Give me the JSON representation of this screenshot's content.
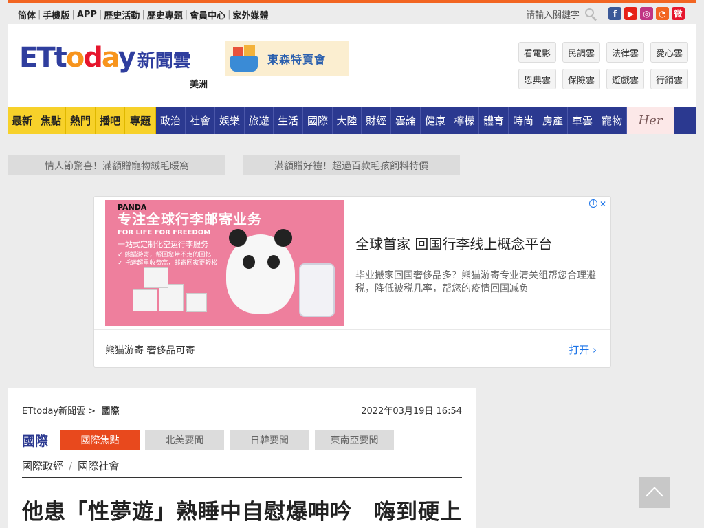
{
  "topbar": {
    "links": [
      "简体",
      "手機版",
      "APP",
      "歷史活動",
      "歷史專題",
      "會員中心",
      "家外媒體"
    ],
    "search_label": "請輸入關鍵字",
    "social": [
      {
        "name": "facebook-icon",
        "glyph": "f",
        "color": "#3b5998"
      },
      {
        "name": "youtube-icon",
        "glyph": "▶",
        "color": "#e62117"
      },
      {
        "name": "instagram-icon",
        "glyph": "◎",
        "color": "#c13584"
      },
      {
        "name": "rss-icon",
        "glyph": "◔",
        "color": "#f26522"
      },
      {
        "name": "weibo-icon",
        "glyph": "微",
        "color": "#e6162d"
      }
    ]
  },
  "header": {
    "logo_et": "ET",
    "logo_today": [
      "t",
      "o",
      "d",
      "a",
      "y"
    ],
    "logo_cn": "新聞雲",
    "region": "美洲",
    "banner_text": "東森特賣會",
    "hubs": [
      "看電影",
      "民調雲",
      "法律雲",
      "愛心雲",
      "恩典雲",
      "保險雲",
      "遊戲雲",
      "行銷雲"
    ]
  },
  "nav": {
    "highlight": [
      "最新",
      "焦點",
      "熱門",
      "播吧",
      "專題"
    ],
    "items": [
      "政治",
      "社會",
      "娛樂",
      "旅遊",
      "生活",
      "國際",
      "大陸",
      "財經",
      "雲論",
      "健康",
      "檸檬",
      "體育",
      "時尚",
      "房產",
      "車雲",
      "寵物"
    ],
    "her": "Her"
  },
  "promos": [
    "情人節驚喜！滿額贈寵物絨毛暖窩",
    "滿額贈好禮！超過百款毛孩飼料特價"
  ],
  "ad": {
    "image": {
      "brand": "PANDA",
      "slogan": "专注全球行李邮寄业务",
      "sub1": "FOR LIFE FOR FREEDOM",
      "sub2": "一站式定制化空运行李服务",
      "sub3": "✓ 熊猫游寄，帮回您带不走的回忆",
      "sub4": "✓ 托运超重收费高，邮寄回家更轻松"
    },
    "headline": "全球首家 回国行李线上概念平台",
    "body": "毕业搬家回国奢侈品多？熊猫游寄专业清关组帮您合理避税，降低被税几率，帮您的疫情回国减负",
    "advertiser": "熊猫游寄 奢侈品可寄",
    "cta": "打开 ›"
  },
  "article": {
    "breadcrumb_site": "ETtoday新聞雲 >",
    "breadcrumb_section": "國際",
    "date": "2022年03月19日 16:54",
    "section_title": "國際",
    "tabs": [
      "國際焦點",
      "北美要聞",
      "日韓要聞",
      "東南亞要聞"
    ],
    "subcats": [
      "國際政經",
      "國際社會"
    ],
    "headline": "他患「性夢遊」熟睡中自慰爆呻吟　嗨到硬上"
  }
}
